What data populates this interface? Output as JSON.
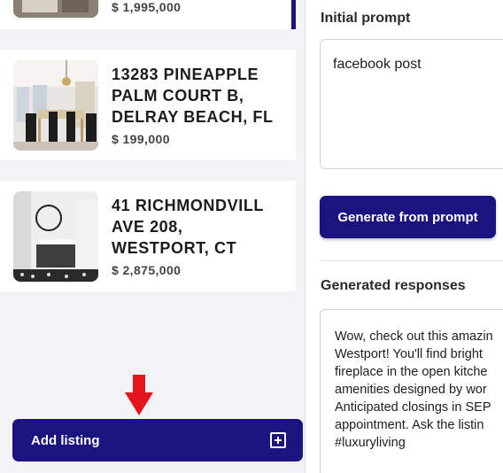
{
  "listings": [
    {
      "title": "",
      "price": "$ 1,995,000",
      "selected": true
    },
    {
      "title_lines": [
        "13283 PINEAPPLE",
        "PALM COURT B,",
        "DELRAY BEACH, FL"
      ],
      "price": "$ 199,000"
    },
    {
      "title_lines": [
        "41 RICHMONDVILL",
        "AVE 208,",
        "WESTPORT, CT"
      ],
      "price": "$ 2,875,000"
    }
  ],
  "add_listing": {
    "label": "Add listing",
    "icon": "plus-square-icon"
  },
  "right_panel": {
    "initial_prompt_label": "Initial prompt",
    "prompt_value": "facebook post",
    "generate_button": "Generate from prompt",
    "generated_label": "Generated responses",
    "response_lines": [
      "Wow, check out this amazin",
      "Westport! You'll find bright",
      "fireplace in the open kitche",
      "amenities designed by wor",
      "Anticipated closings in SEP",
      "appointment. Ask the listin",
      "#luxuryliving"
    ]
  },
  "colors": {
    "primary": "#1a1380",
    "arrow": "#e5151c"
  }
}
